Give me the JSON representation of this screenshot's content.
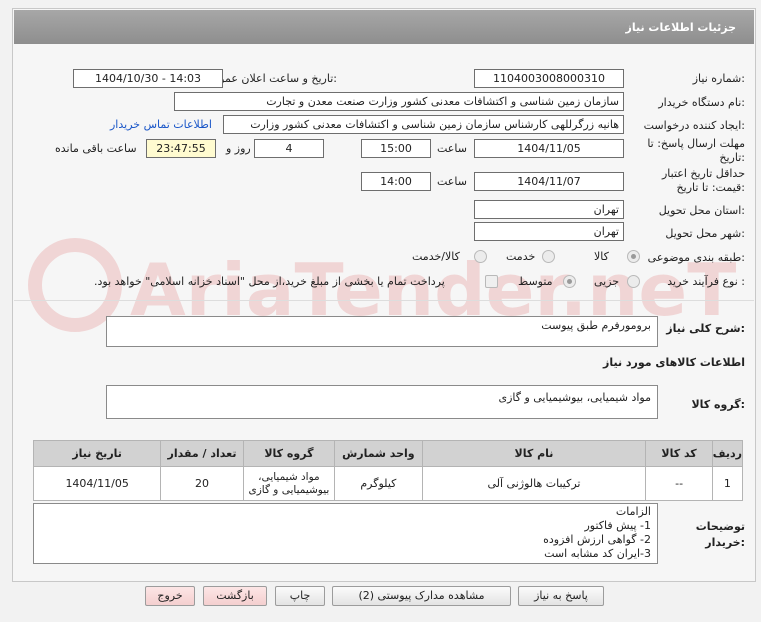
{
  "header": {
    "title": "جزئیات اطلاعات نیاز"
  },
  "fields": {
    "need_number_label": "شماره نیاز:",
    "need_number": "1104003008000310",
    "announce_label": "تاریخ و ساعت اعلان عمومی:",
    "announce_value": "1404/10/30 - 14:03",
    "buyer_org_label": "نام دستگاه خریدار:",
    "buyer_org": "سازمان زمین شناسی و اکتشافات معدنی کشور وزارت صنعت معدن و تجارت",
    "creator_label": "ایجاد کننده درخواست:",
    "creator": "هانیه زرگرللهی کارشناس سازمان زمین شناسی و اکتشافات معدنی کشور وزارت",
    "contact_link": "اطلاعات تماس خریدار",
    "deadline_label_1": "مهلت ارسال پاسخ: تا",
    "deadline_label_2": "تاریخ:",
    "deadline_date": "1404/11/05",
    "time_label": "ساعت",
    "deadline_time": "15:00",
    "days_value": "4",
    "days_label": "روز و",
    "remaining_time": "23:47:55",
    "remaining_label": "ساعت باقی مانده",
    "validity_label_1": "حداقل تاریخ اعتبار",
    "validity_label_2": "قیمت: تا تاریخ:",
    "validity_date": "1404/11/07",
    "validity_time": "14:00",
    "province_label": "استان محل تحویل:",
    "province": "تهران",
    "city_label": "شهر محل تحویل:",
    "city": "تهران",
    "category_label": "طبقه بندی موضوعی:",
    "category_options": [
      "کالا",
      "خدمت",
      "کالا/خدمت"
    ],
    "process_label": "نوع فرآیند خرید :",
    "process_options": [
      "جزیی",
      "متوسط"
    ],
    "payment_note": "پرداخت تمام یا بخشی از مبلغ خرید،از محل \"اسناد خزانه اسلامی\" خواهد بود."
  },
  "description": {
    "label": "شرح کلی نیاز:",
    "value": "برومورفرم طبق پیوست"
  },
  "goods_section": {
    "title": "اطلاعات کالاهای مورد نیاز"
  },
  "goods_group": {
    "label": "گروه کالا:",
    "value": "مواد شیمیایی، بیوشیمیایی و  گازی"
  },
  "table": {
    "headers": [
      "ردیف",
      "کد کالا",
      "نام کالا",
      "واحد شمارش",
      "گروه کالا",
      "تعداد / مقدار",
      "تاریخ نیاز"
    ],
    "rows": [
      [
        "1",
        "--",
        "ترکیبات هالوژنی آلی",
        "کیلوگرم",
        "مواد شیمیایی، بیوشیمیایی و گازی",
        "20",
        "1404/11/05"
      ]
    ]
  },
  "buyer_notes": {
    "label_1": "توضیحات",
    "label_2": "خریدار:",
    "lines": [
      "الزامات",
      "1-  پیش فاکتور",
      "2- گواهی ارزش افزوده",
      "3-ایران کد مشابه است"
    ]
  },
  "buttons": {
    "reply": "پاسخ به نیاز",
    "docs": "مشاهده مدارک پیوستی (2)",
    "print": "چاپ",
    "back": "بازگشت",
    "exit": "خروج"
  },
  "watermark": {
    "text": "AriaTender.neT"
  }
}
